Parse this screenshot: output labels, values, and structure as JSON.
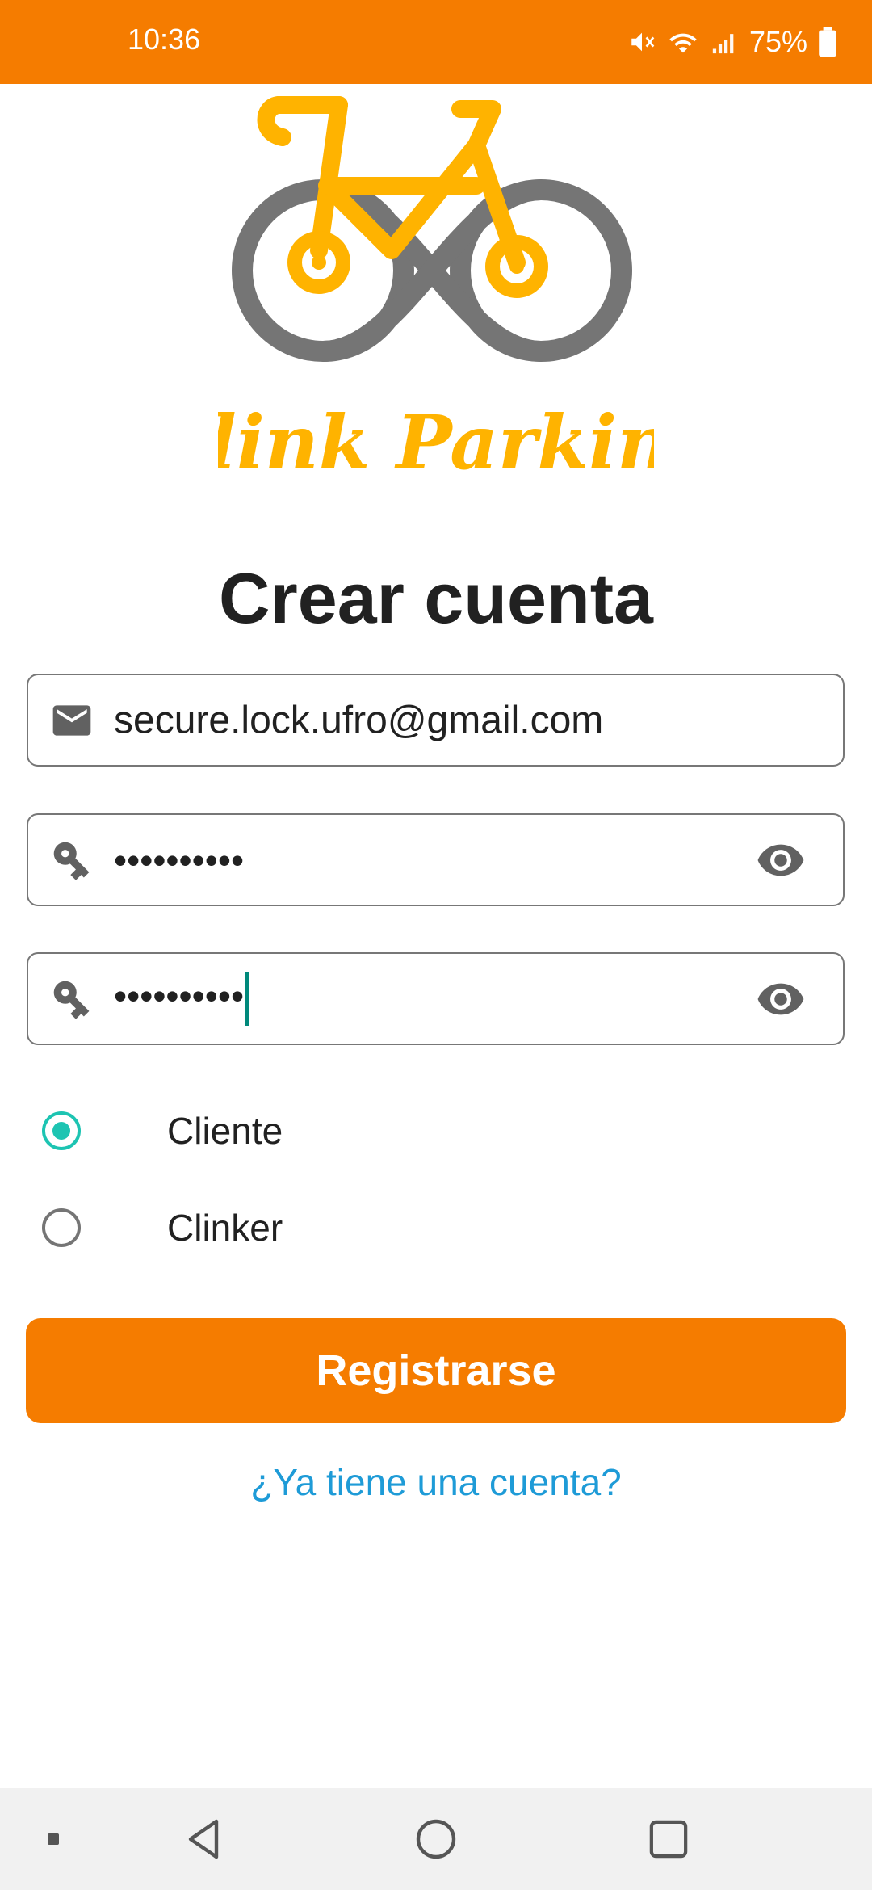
{
  "status_bar": {
    "time": "10:36",
    "battery": "75%",
    "color": "#F57C00"
  },
  "logo": {
    "text": "Clink Parking"
  },
  "page": {
    "title": "Crear cuenta"
  },
  "form": {
    "email_value": "secure.lock.ufro@gmail.com",
    "password_value": "••••••••••",
    "confirm_password_value": "••••••••••",
    "role_options": [
      {
        "label": "Cliente",
        "selected": true
      },
      {
        "label": "Clinker",
        "selected": false
      }
    ],
    "submit_label": "Registrarse",
    "login_link": "¿Ya tiene una cuenta?"
  },
  "colors": {
    "accent": "#F57C00",
    "radio_selected": "#1DC4B2",
    "link": "#1E9BD7"
  },
  "icons": {
    "email": "mail-icon",
    "password": "key-icon",
    "visibility": "eye-icon"
  }
}
